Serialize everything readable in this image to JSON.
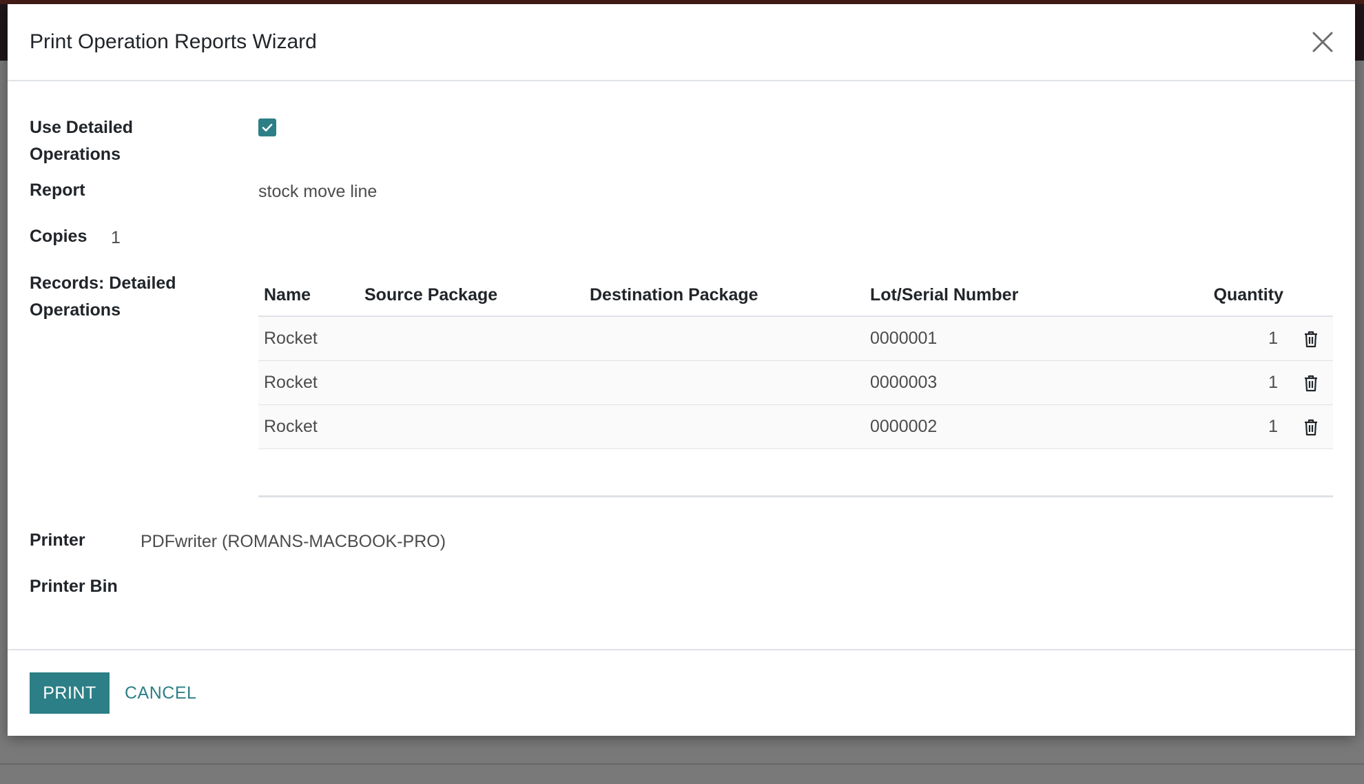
{
  "dialog": {
    "title": "Print Operation Reports Wizard"
  },
  "form": {
    "use_detailed_label_line1": "Use Detailed",
    "use_detailed_label_line2": "Operations",
    "use_detailed_checked": true,
    "report_label": "Report",
    "report_value": "stock move line",
    "copies_label": "Copies",
    "copies_value": "1",
    "records_label_line1": "Records: Detailed",
    "records_label_line2": "Operations",
    "printer_label": "Printer",
    "printer_value": "PDFwriter (ROMANS-MACBOOK-PRO)",
    "printer_bin_label": "Printer Bin"
  },
  "table": {
    "columns": [
      "Name",
      "Source Package",
      "Destination Package",
      "Lot/Serial Number",
      "Quantity"
    ],
    "rows": [
      {
        "name": "Rocket",
        "source_package": "",
        "destination_package": "",
        "lot": "0000001",
        "quantity": "1"
      },
      {
        "name": "Rocket",
        "source_package": "",
        "destination_package": "",
        "lot": "0000003",
        "quantity": "1"
      },
      {
        "name": "Rocket",
        "source_package": "",
        "destination_package": "",
        "lot": "0000002",
        "quantity": "1"
      }
    ]
  },
  "footer": {
    "print_label": "PRINT",
    "cancel_label": "CANCEL"
  },
  "colors": {
    "accent": "#2c7f86",
    "overlay": "rgba(0,0,0,0.5)"
  },
  "icons": {
    "close": "close-icon",
    "check": "checkmark-icon",
    "delete": "trash-icon"
  }
}
